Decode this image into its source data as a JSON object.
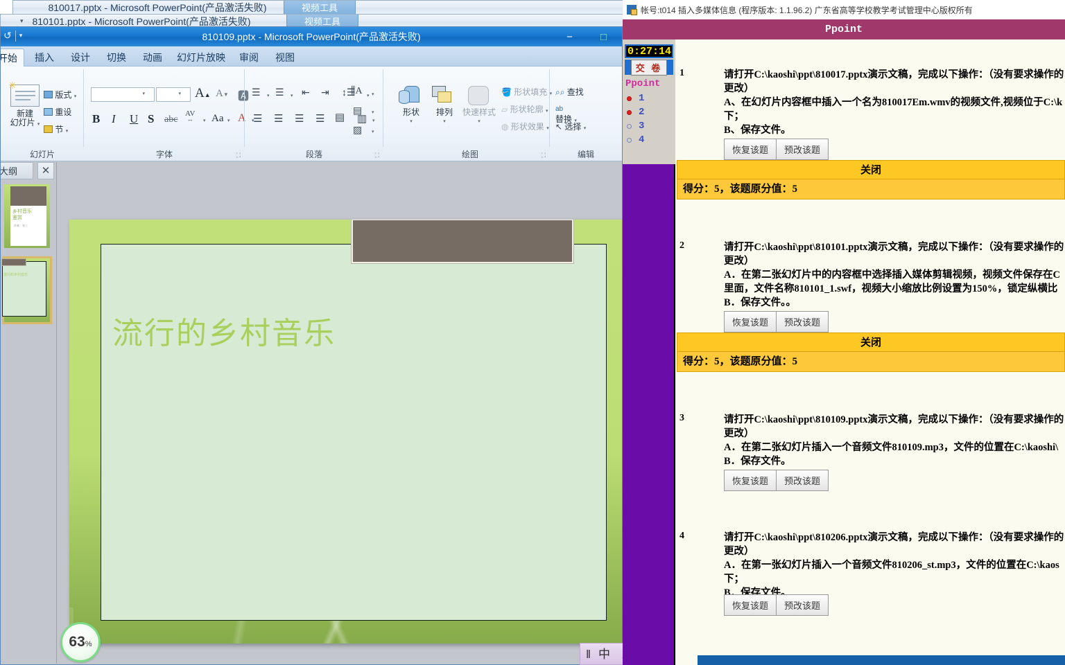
{
  "windows": {
    "back2": {
      "title": "810017.pptx  -  Microsoft PowerPoint(产品激活失败)",
      "context_tab": "视频工具",
      "minimize": "−",
      "maximize": "□",
      "close": "✕"
    },
    "back1": {
      "title": "810101.pptx  -  Microsoft PowerPoint(产品激活失败)",
      "context_tab": "视频工具",
      "minimize": "−",
      "maximize": "□",
      "close": "✕"
    },
    "active": {
      "title": "810109.pptx  -  Microsoft PowerPoint(产品激活失败)",
      "minimize": "−",
      "maximize": "□",
      "qat": {
        "save_icon": "save-icon",
        "undo_icon": "↺",
        "customize_icon": "▾"
      }
    }
  },
  "ribbon": {
    "tabs": [
      {
        "label": "开始",
        "selected": true
      },
      {
        "label": "插入",
        "selected": false
      },
      {
        "label": "设计",
        "selected": false
      },
      {
        "label": "切换",
        "selected": false
      },
      {
        "label": "动画",
        "selected": false
      },
      {
        "label": "幻灯片放映",
        "selected": false
      },
      {
        "label": "审阅",
        "selected": false
      },
      {
        "label": "视图",
        "selected": false
      }
    ],
    "groups": [
      {
        "name": "幻灯片",
        "big": "新建\n幻灯片",
        "items": [
          "版式",
          "重设",
          "节"
        ]
      },
      {
        "name": "字体",
        "font_name": "",
        "font_size": "",
        "grow": "A",
        "shrink": "A",
        "clear": "clear-format-icon",
        "buttons": [
          "B",
          "I",
          "U",
          "S",
          "abc",
          "AV",
          "Aa",
          "A"
        ]
      },
      {
        "name": "段落",
        "buttons": [
          "bullets",
          "numbering",
          "decrease-indent",
          "increase-indent",
          "line-spacing",
          "text-direction",
          "align-text",
          "convert-smartart",
          "align-left",
          "align-center",
          "align-right",
          "justify",
          "columns"
        ]
      },
      {
        "name": "绘图",
        "big": [
          "形状",
          "排列",
          "快速样式"
        ],
        "items": [
          "形状填充",
          "形状轮廓",
          "形状效果"
        ]
      },
      {
        "name": "编辑",
        "items": [
          "查找",
          "替换",
          "选择"
        ]
      }
    ]
  },
  "left_pane": {
    "tab": "大纲",
    "close": "✕",
    "thumb1_title": "乡村音乐\n鉴赏",
    "thumb1_sub": "作者：张三"
  },
  "slide": {
    "title": "流行的乡村音乐",
    "zoom": "63",
    "zoom_unit": "%"
  },
  "ime": {
    "keyboard": "‖",
    "mode": "中",
    "shape": "☽",
    "punct": "°,",
    "emoji": "☺",
    "settings": "⚙"
  },
  "exam": {
    "account_line": "帐号:t014  插入多媒体信息  (程序版本: 1.1.96.2)  广东省高等学校教学考试管理中心版权所有",
    "banner": "Ppoint",
    "timer": "0:27:14",
    "submit": "交 卷",
    "nav_group": "Ppoint",
    "nav_items": [
      {
        "num": "1",
        "answered": true
      },
      {
        "num": "2",
        "answered": true
      },
      {
        "num": "3",
        "answered": false
      },
      {
        "num": "4",
        "answered": false
      }
    ],
    "btn_restore": "恢复该题",
    "btn_pregrade": "预改该题",
    "btn_close": "关闭",
    "questions": [
      {
        "num": "1",
        "text": "请打开C:\\kaoshi\\ppt\\810017.pptx演示文稿，完成以下操作：（没有要求操作的\n更改）\nA、在幻灯片内容框中插入一个名为810017Em.wmv的视频文件,视频位于C:\\k\n下；\nB、保存文件。",
        "score": "得分：5，该题原分值：5"
      },
      {
        "num": "2",
        "text": "请打开C:\\kaoshi\\ppt\\810101.pptx演示文稿，完成以下操作：（没有要求操作的\n更改）\nA．在第二张幻灯片中的内容框中选择插入媒体剪辑视频，视频文件保存在C\n里面，文件名称810101_1.swf，视频大小缩放比例设置为150%，锁定纵横比\nB．保存文件。。",
        "score": "得分：5，该题原分值：5"
      },
      {
        "num": "3",
        "text": "请打开C:\\kaoshi\\ppt\\810109.pptx演示文稿，完成以下操作：（没有要求操作的\n更改）\nA．在第二张幻灯片插入一个音频文件810109.mp3，文件的位置在C:\\kaoshi\\\nB．保存文件。",
        "score": null
      },
      {
        "num": "4",
        "text": "请打开C:\\kaoshi\\ppt\\810206.pptx演示文稿，完成以下操作：（没有要求操作的\n更改）\nA．在第一张幻灯片插入一个音频文件810206_st.mp3，文件的位置在C:\\kaos\n下；\nB．保存文件。",
        "score": null
      }
    ]
  }
}
